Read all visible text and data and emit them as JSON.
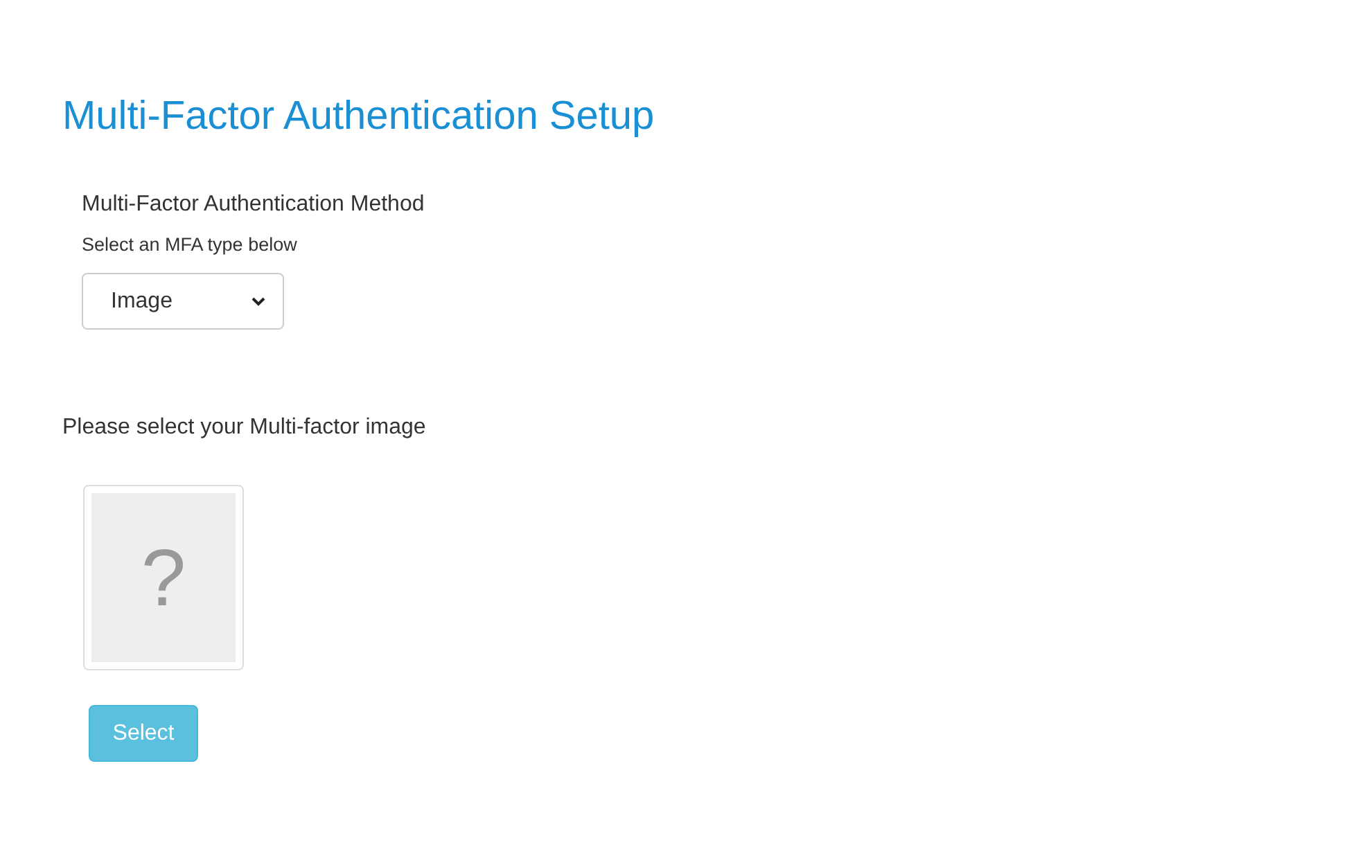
{
  "title": "Multi-Factor Authentication Setup",
  "method": {
    "label": "Multi-Factor Authentication Method",
    "hint": "Select an MFA type below",
    "value": "Image"
  },
  "image_section": {
    "prompt": "Please select your Multi-factor image",
    "placeholder_glyph": "?",
    "button": "Select"
  }
}
